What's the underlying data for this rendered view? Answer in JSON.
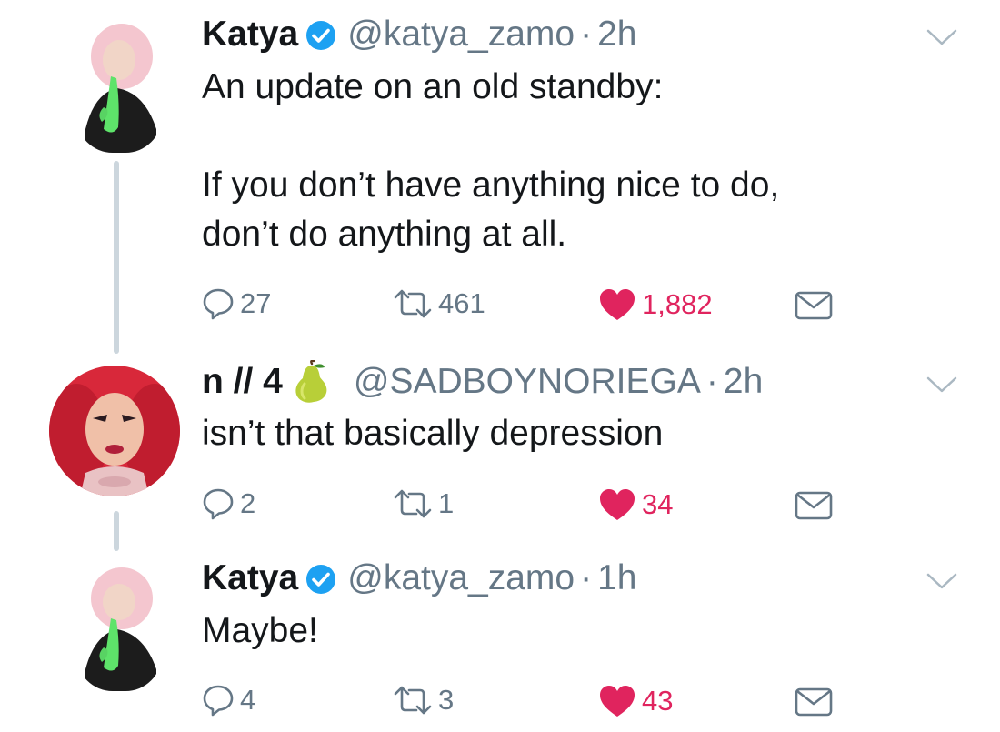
{
  "tweets": [
    {
      "name": "Katya",
      "verified": true,
      "handle": "@katya_zamo",
      "separator": "·",
      "time": "2h",
      "text": "An update on an old standby:\n\nIf you don’t have anything nice to do,\ndon’t do anything at all.",
      "replies": "27",
      "retweets": "461",
      "likes": "1,882",
      "liked": true
    },
    {
      "name": "n // 4",
      "emoji": "pear",
      "handle": "@SADBOYNORIEGA",
      "separator": "·",
      "time": "2h",
      "text": "isn’t that basically depression",
      "replies": "2",
      "retweets": "1",
      "likes": "34",
      "liked": true
    },
    {
      "name": "Katya",
      "verified": true,
      "handle": "@katya_zamo",
      "separator": "·",
      "time": "1h",
      "text": "Maybe!",
      "replies": "4",
      "retweets": "3",
      "likes": "43",
      "liked": true
    }
  ],
  "colors": {
    "text": "#14171a",
    "secondary": "#657786",
    "like": "#e0245e",
    "verified": "#1da1f2",
    "thread_line": "#ccd6dd"
  },
  "icons": [
    "reply-icon",
    "retweet-icon",
    "heart-icon",
    "dm-icon",
    "caret-down-icon",
    "verified-badge-icon",
    "pear-emoji-icon"
  ]
}
